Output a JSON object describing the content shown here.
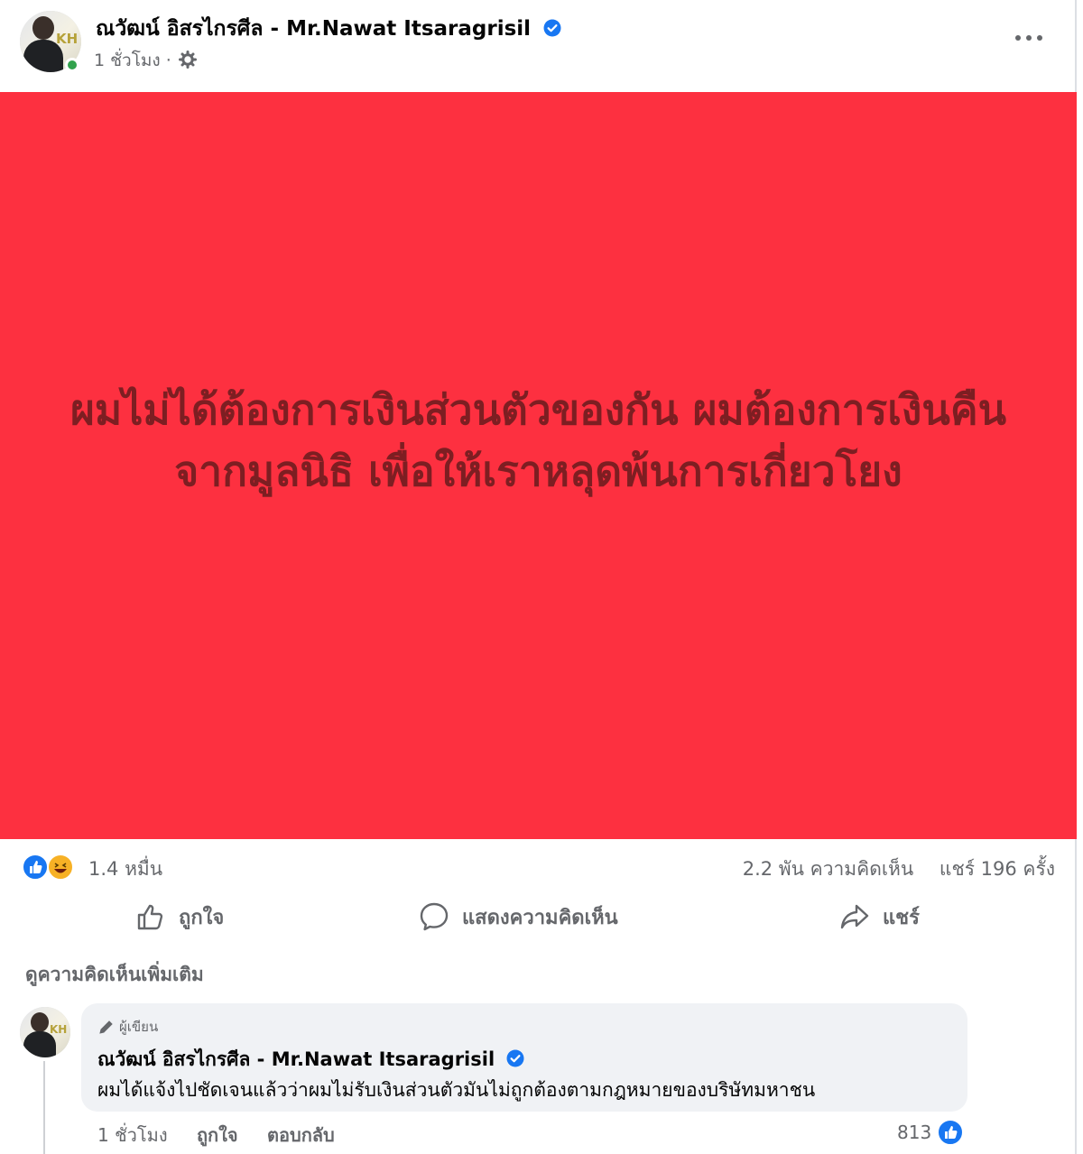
{
  "post": {
    "author_name": "ณวัฒน์ อิสรไกรศีล - Mr.Nawat Itsaragrisil",
    "time": "1 ชั่วโมง ·",
    "image_text": "ผมไม่ได้ต้องการเงินส่วนตัวของกัน ผมต้องการเงินคืนจากมูลนิธิ เพื่อให้เราหลุดพ้นการเกี่ยวโยง",
    "image_color": "#fd3040",
    "image_text_color": "#7d1e22"
  },
  "stats": {
    "reactions": "1.4 หมื่น",
    "comments": "2.2 พัน ความคิดเห็น",
    "shares": "แชร์ 196 ครั้ง"
  },
  "actions": {
    "like": "ถูกใจ",
    "comment": "แสดงความคิดเห็น",
    "share": "แชร์"
  },
  "comments_section": {
    "view_more": "ดูความคิดเห็นเพิ่มเติม"
  },
  "comment": {
    "badge": "ผู้เขียน",
    "author_name": "ณวัฒน์ อิสรไกรศีล - Mr.Nawat Itsaragrisil",
    "text": "ผมได้แจ้งไปชัดเจนแล้วว่าผมไม่รับเงินส่วนตัวมันไม่ถูกต้องตามกฎหมายของบริษัทมหาชน",
    "time": "1 ชั่วโมง",
    "like": "ถูกใจ",
    "reply": "ตอบกลับ",
    "likes_count": "813"
  },
  "icons": {
    "verified": "verified-badge-icon",
    "audience": "gear-icon",
    "more": "more-options-icon",
    "like_reaction": "like-reaction-icon",
    "haha_reaction": "haha-reaction-icon",
    "like_action": "thumbs-up-icon",
    "comment_action": "comment-icon",
    "share_action": "share-icon",
    "author_badge": "pencil-icon"
  },
  "colors": {
    "brand_blue": "#1877f2",
    "secondary_text": "#65676b",
    "bubble": "#f0f2f5",
    "online": "#31a24c"
  }
}
